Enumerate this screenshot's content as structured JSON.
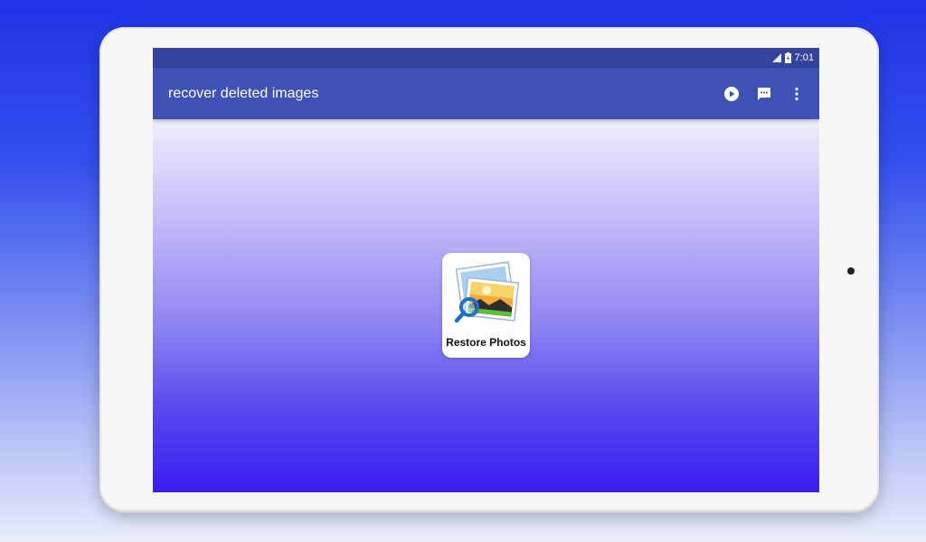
{
  "status_bar": {
    "time": "7:01"
  },
  "app_bar": {
    "title": "recover deleted images",
    "actions": [
      {
        "icon": "play-circle-icon"
      },
      {
        "icon": "message-icon"
      },
      {
        "icon": "more-vert-icon"
      }
    ]
  },
  "main": {
    "restore_button": {
      "label": "Restore Photos",
      "icon": "photo-search-icon"
    }
  },
  "colors": {
    "status_bar": "#34449e",
    "app_bar": "#3f51b5",
    "gradient_top": "#f1eefc",
    "gradient_bottom": "#3a1cf0"
  }
}
